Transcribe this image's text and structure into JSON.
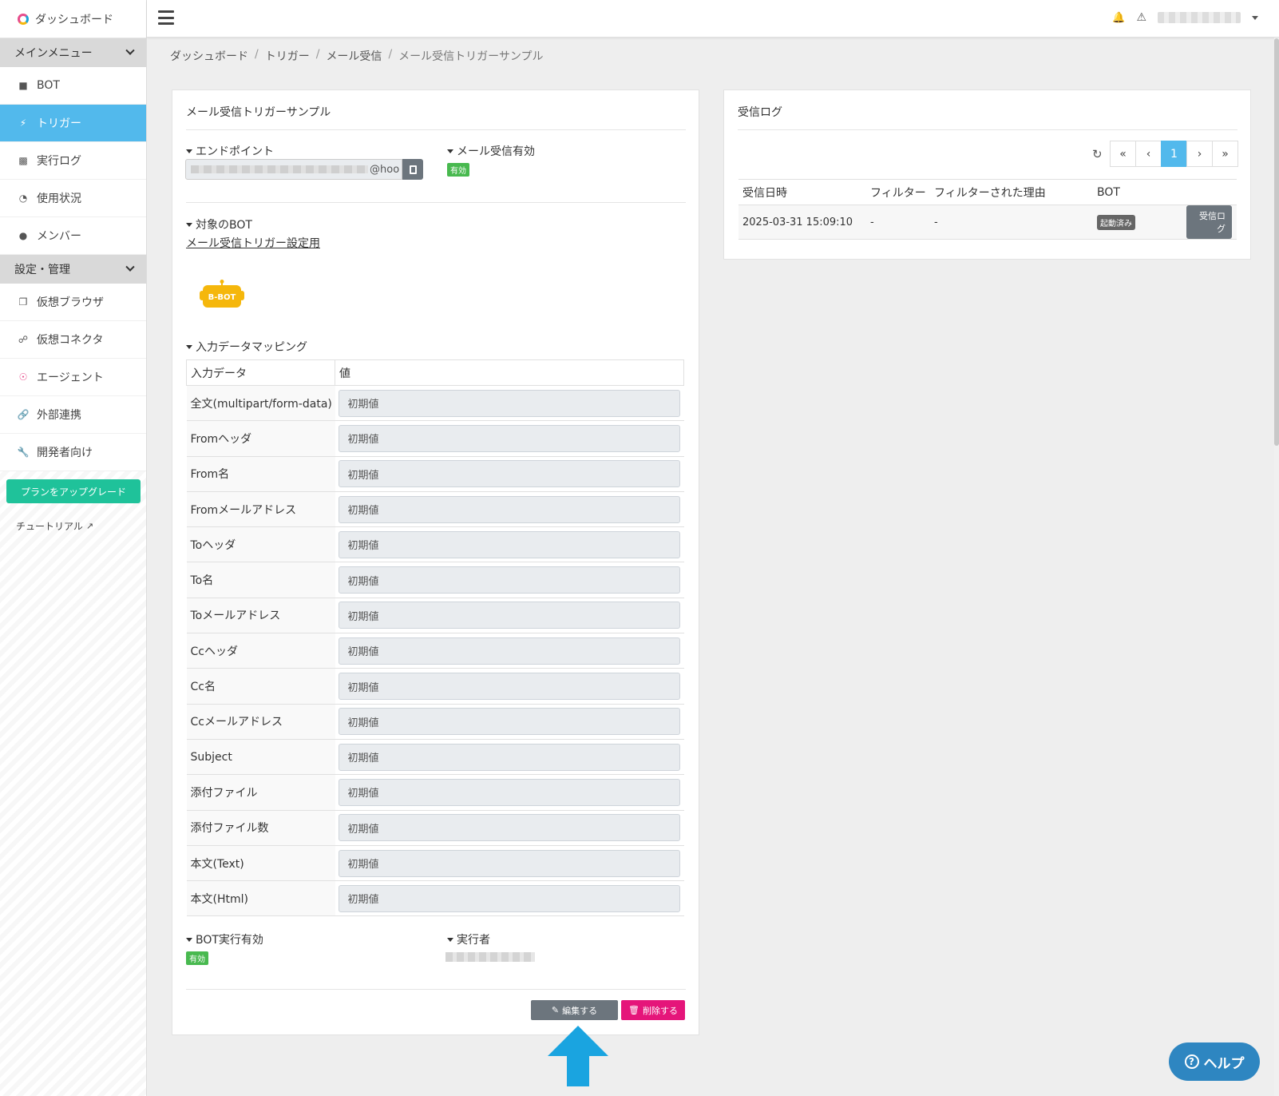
{
  "sidebar": {
    "top_label": "ダッシュボード",
    "section_main": "メインメニュー",
    "main_items": [
      {
        "label": "BOT"
      },
      {
        "label": "トリガー"
      },
      {
        "label": "実行ログ"
      },
      {
        "label": "使用状況"
      },
      {
        "label": "メンバー"
      }
    ],
    "section_settings": "設定・管理",
    "settings_items": [
      {
        "label": "仮想ブラウザ"
      },
      {
        "label": "仮想コネクタ"
      },
      {
        "label": "エージェント"
      },
      {
        "label": "外部連携"
      },
      {
        "label": "開発者向け"
      }
    ],
    "upgrade_label": "プランをアップグレード",
    "tutorial_label": "チュートリアル"
  },
  "breadcrumb": [
    "ダッシュボード",
    "トリガー",
    "メール受信",
    "メール受信トリガーサンプル"
  ],
  "trigger": {
    "title": "メール受信トリガーサンプル",
    "endpoint_label": "エンドポイント",
    "endpoint_suffix": "@hoo",
    "mail_enabled_label": "メール受信有効",
    "mail_enabled_badge": "有効",
    "target_bot_label": "対象のBOT",
    "target_bot_link": "メール受信トリガー設定用",
    "bot_logo_text": "B-BOT",
    "mapping_label": "入力データマッピング",
    "mapping_headers": [
      "入力データ",
      "値"
    ],
    "mapping_rows": [
      {
        "name": "全文(multipart/form-data)",
        "value": "初期値"
      },
      {
        "name": "Fromヘッダ",
        "value": "初期値"
      },
      {
        "name": "From名",
        "value": "初期値"
      },
      {
        "name": "Fromメールアドレス",
        "value": "初期値"
      },
      {
        "name": "Toヘッダ",
        "value": "初期値"
      },
      {
        "name": "To名",
        "value": "初期値"
      },
      {
        "name": "Toメールアドレス",
        "value": "初期値"
      },
      {
        "name": "Ccヘッダ",
        "value": "初期値"
      },
      {
        "name": "Cc名",
        "value": "初期値"
      },
      {
        "name": "Ccメールアドレス",
        "value": "初期値"
      },
      {
        "name": "Subject",
        "value": "初期値"
      },
      {
        "name": "添付ファイル",
        "value": "初期値"
      },
      {
        "name": "添付ファイル数",
        "value": "初期値"
      },
      {
        "name": "本文(Text)",
        "value": "初期値"
      },
      {
        "name": "本文(Html)",
        "value": "初期値"
      }
    ],
    "bot_exec_label": "BOT実行有効",
    "bot_exec_badge": "有効",
    "executor_label": "実行者",
    "edit_label": "編集する",
    "delete_label": "削除する"
  },
  "log": {
    "title": "受信ログ",
    "page": "1",
    "headers": [
      "受信日時",
      "フィルター",
      "フィルターされた理由",
      "BOT"
    ],
    "rows": [
      {
        "datetime": "2025-03-31 15:09:10",
        "filter": "-",
        "reason": "-",
        "status": "起動済み",
        "button": "受信ログ"
      }
    ]
  },
  "help_label": "ヘルプ",
  "colors": {
    "accent": "#52b9ec",
    "success": "#48b94f",
    "danger": "#e5157a",
    "upgrade": "#1fc29a",
    "arrow": "#1aa4e0"
  }
}
